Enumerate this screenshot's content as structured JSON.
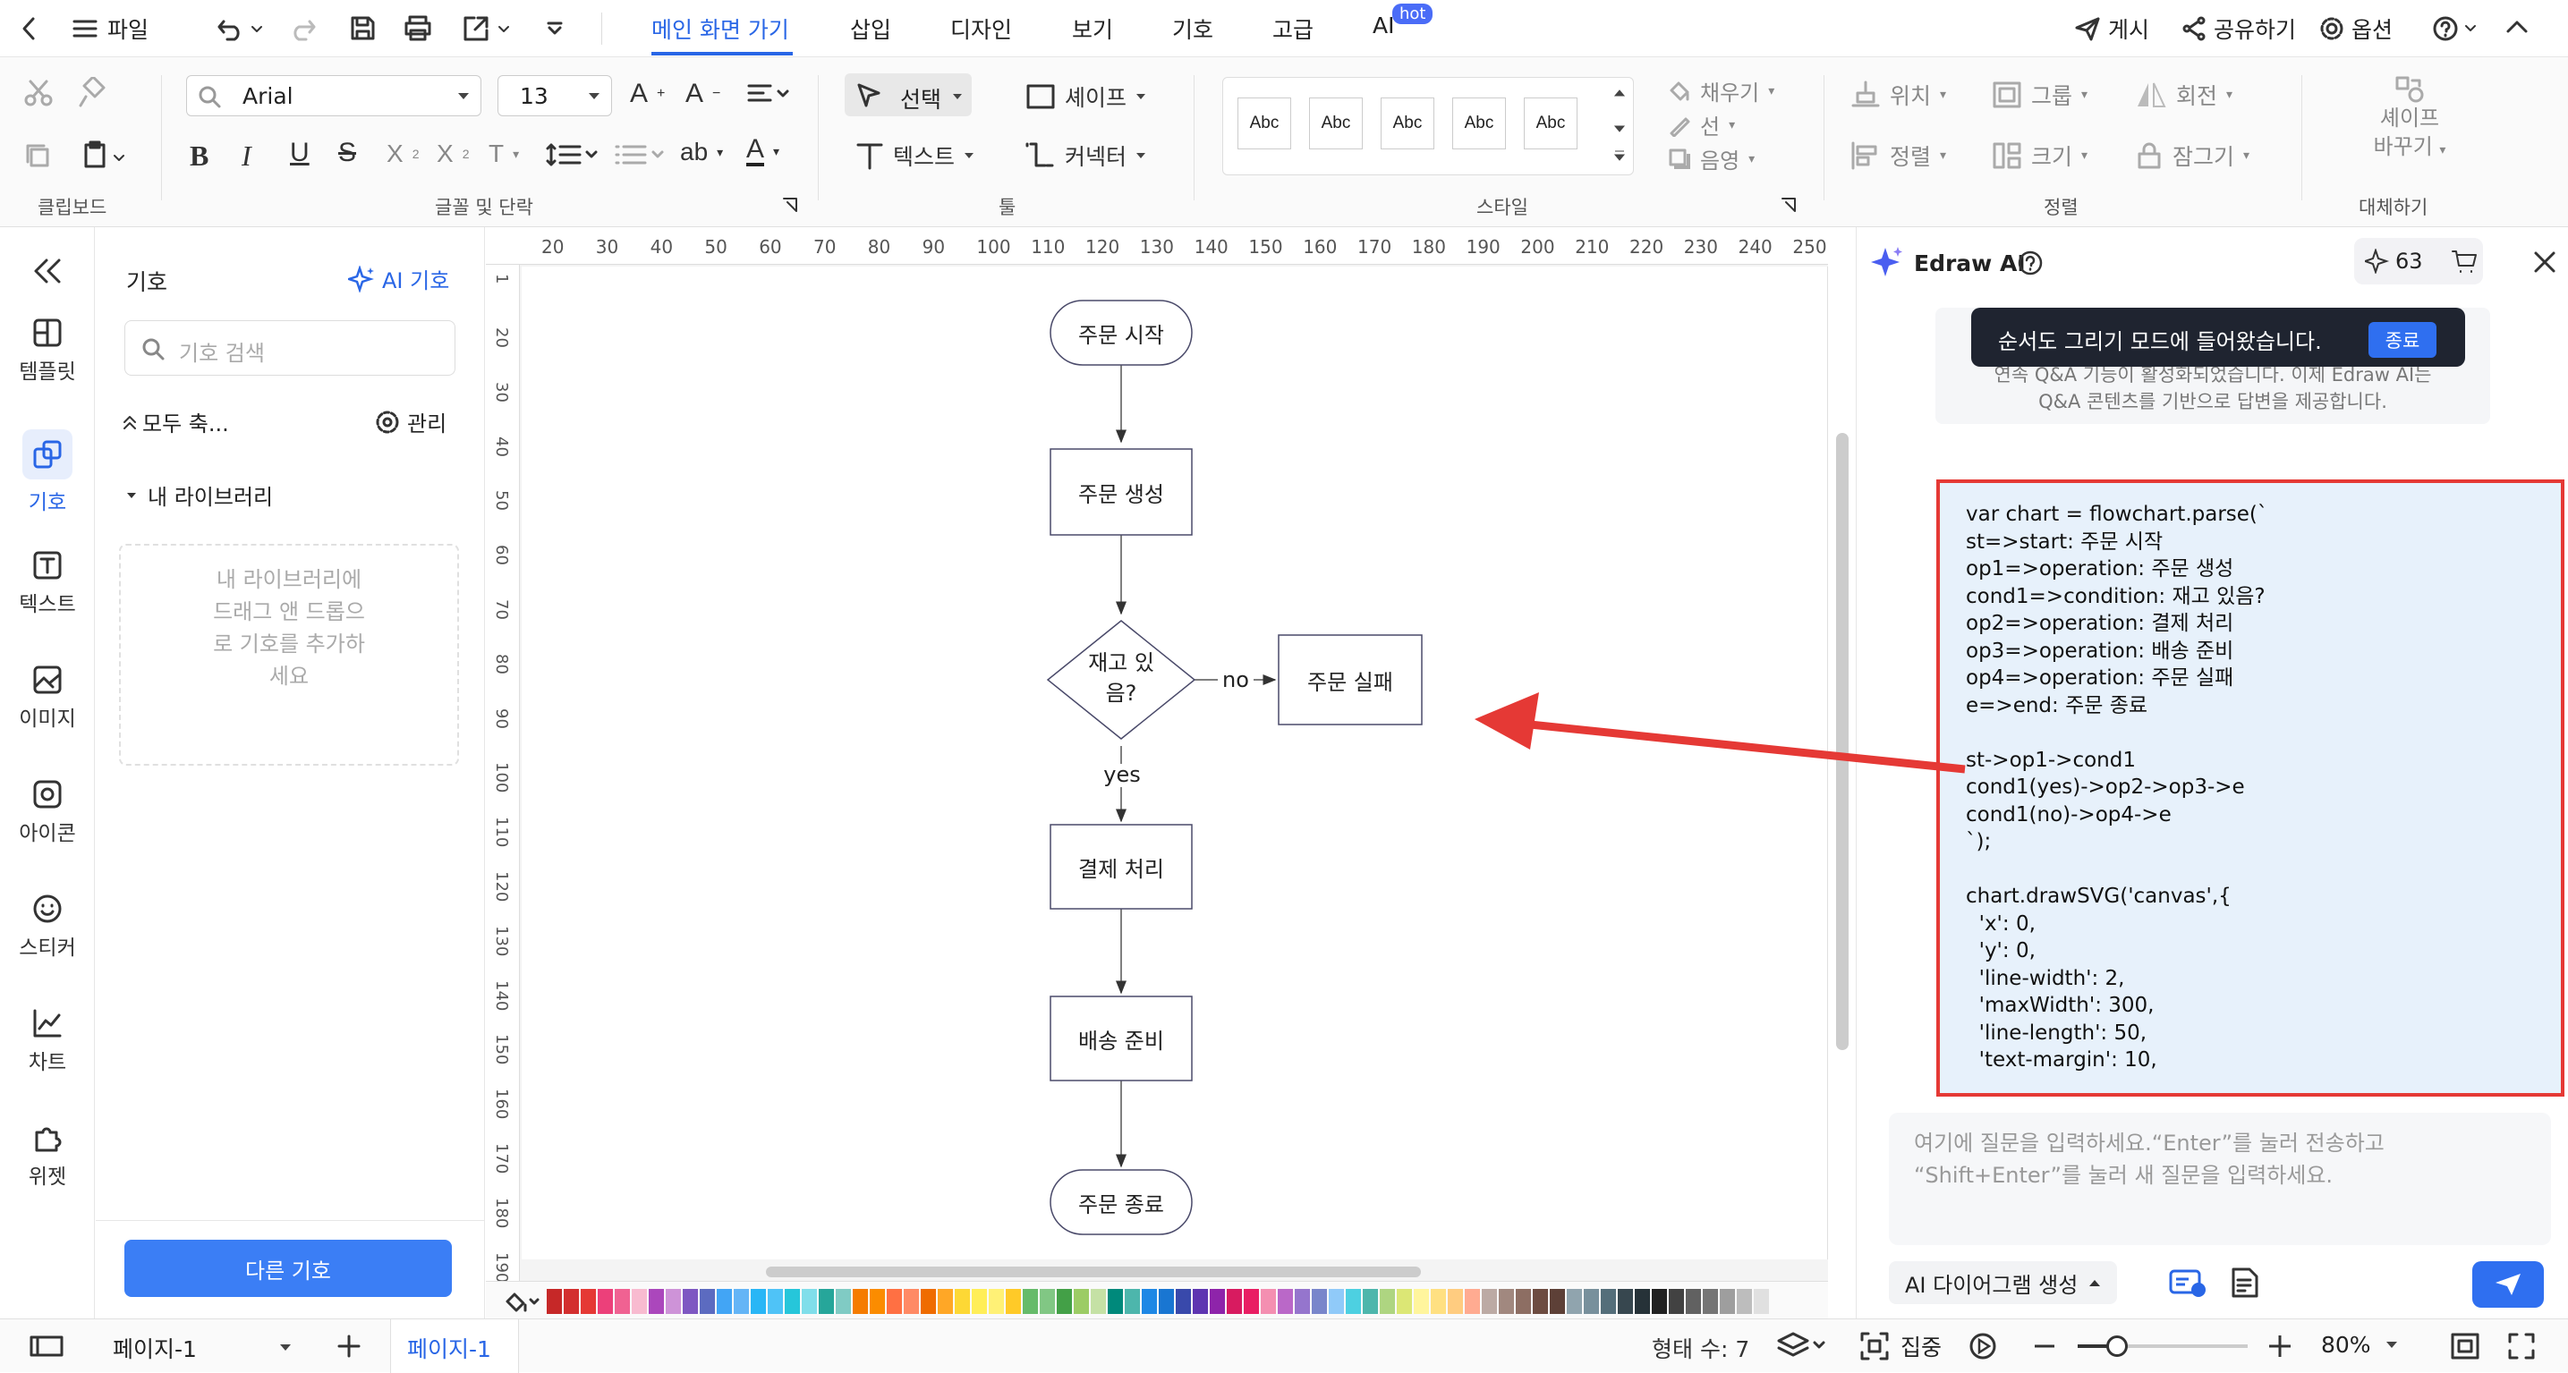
{
  "titlebar": {
    "file": "파일",
    "tabs": [
      "메인 화면 가기",
      "삽입",
      "디자인",
      "보기",
      "기호",
      "고급",
      "AI"
    ],
    "hot_badge": "hot",
    "post": "게시",
    "share": "공유하기",
    "options": "옵션"
  },
  "ribbon": {
    "font_name": "Arial",
    "font_size": "13",
    "select": "선택",
    "shape": "셰이프",
    "text": "텍스트",
    "connector": "커넥터",
    "style_sample": "Abc",
    "fill": "채우기",
    "line": "선",
    "shadow": "음영",
    "position": "위치",
    "group": "그룹",
    "rotate": "회전",
    "align": "정렬",
    "size": "크기",
    "lock": "잠그기",
    "replace_shape_1": "셰이프",
    "replace_shape_2": "바꾸기",
    "groups": {
      "clipboard": "클립보드",
      "font_paragraph": "글꼴 및 단락",
      "tools": "툴",
      "style": "스타일",
      "arrange": "정렬",
      "replace": "대체하기"
    }
  },
  "leftbar": {
    "items": [
      "템플릿",
      "기호",
      "텍스트",
      "이미지",
      "아이콘",
      "스티커",
      "차트",
      "위젯"
    ]
  },
  "symbols": {
    "title": "기호",
    "ai_symbols": "AI 기호",
    "search_placeholder": "기호 검색",
    "collapse_all": "모두 축...",
    "manage": "관리",
    "my_library": "내 라이브러리",
    "empty_hint_1": "내 라이브러리에",
    "empty_hint_2": "드래그 앤 드롭으",
    "empty_hint_3": "로 기호를 추가하",
    "empty_hint_4": "세요",
    "more_button": "다른 기호"
  },
  "ruler": {
    "top": [
      "20",
      "30",
      "40",
      "50",
      "60",
      "70",
      "80",
      "90",
      "100",
      "110",
      "120",
      "130",
      "140",
      "150",
      "160",
      "170",
      "180",
      "190",
      "200",
      "210",
      "220",
      "230",
      "240",
      "250"
    ],
    "left": [
      "1",
      "20",
      "30",
      "40",
      "50",
      "60",
      "70",
      "80",
      "90",
      "100",
      "110",
      "120",
      "130",
      "140",
      "150",
      "160",
      "170",
      "180",
      "190"
    ]
  },
  "flowchart": {
    "start": "주문 시작",
    "create": "주문 생성",
    "cond_1": "재고 있",
    "cond_2": "음?",
    "no": "no",
    "fail": "주문 실패",
    "yes": "yes",
    "pay": "결제 처리",
    "ship": "배송 준비",
    "end": "주문 종료"
  },
  "palette": [
    "#c62828",
    "#d32f2f",
    "#e53935",
    "#ec407a",
    "#f06292",
    "#f8bbd0",
    "#ab47bc",
    "#ce93d8",
    "#7e57c2",
    "#5c6bc0",
    "#42a5f5",
    "#64b5f6",
    "#29b6f6",
    "#4fc3f7",
    "#26c6da",
    "#80deea",
    "#26a69a",
    "#80cbc4",
    "#f57c00",
    "#fb8c00",
    "#ff7043",
    "#ff8a65",
    "#ef6c00",
    "#ffa726",
    "#fdd835",
    "#ffee58",
    "#fff176",
    "#ffca28",
    "#66bb6a",
    "#81c784",
    "#43a047",
    "#9ccc65",
    "#c5e1a5",
    "#00897b",
    "#4db6ac",
    "#1e88e5",
    "#1976d2",
    "#3949ab",
    "#5e35b1",
    "#8e24aa",
    "#d81b60",
    "#e91e63",
    "#f48fb1",
    "#ba68c8",
    "#9575cd",
    "#7986cb",
    "#90caf9",
    "#4dd0e1",
    "#4db6ac",
    "#aed581",
    "#dce775",
    "#fff59d",
    "#ffe082",
    "#ffcc80",
    "#ffab91",
    "#bcaaa4",
    "#a1887f",
    "#8d6e63",
    "#6d4c41",
    "#5d4037",
    "#90a4ae",
    "#78909c",
    "#546e7a",
    "#37474f",
    "#263238",
    "#212121",
    "#424242",
    "#616161",
    "#757575",
    "#9e9e9e",
    "#bdbdbd",
    "#e0e0e0"
  ],
  "ai": {
    "title": "Edraw AI",
    "credits": "63",
    "toast": "순서도 그리기 모드에 들어왔습니다.",
    "toast_button": "종료",
    "info_1": "연속 Q&A 기능이 활성화되었습니다. 이제 Edraw AI는",
    "info_2": "Q&A 콘텐츠를 기반으로 답변을 제공합니다.",
    "code": [
      "var chart = flowchart.parse(`",
      "st=>start: 주문 시작",
      "op1=>operation: 주문 생성",
      "cond1=>condition: 재고 있음?",
      "op2=>operation: 결제 처리",
      "op3=>operation: 배송 준비",
      "op4=>operation: 주문 실패",
      "e=>end: 주문 종료",
      "",
      "st->op1->cond1",
      "cond1(yes)->op2->op3->e",
      "cond1(no)->op4->e",
      "`);",
      "",
      "chart.drawSVG('canvas',{",
      "  'x': 0,",
      "  'y': 0,",
      "  'line-width': 2,",
      "  'maxWidth': 300,",
      "  'line-length': 50,",
      "  'text-margin': 10,"
    ],
    "input_placeholder_1": "여기에 질문을 입력하세요.“Enter”를 눌러 전송하고",
    "input_placeholder_2": "“Shift+Enter”를 눌러 새 질문을 입력하세요.",
    "generate": "AI 다이어그램 생성",
    "accent": "#2966e6",
    "highlight": "#e53935"
  },
  "status": {
    "page_select": "페이지-1",
    "page_tab": "페이지-1",
    "shape_count": "형태 수: 7",
    "focus": "집중",
    "zoom": "80%"
  }
}
